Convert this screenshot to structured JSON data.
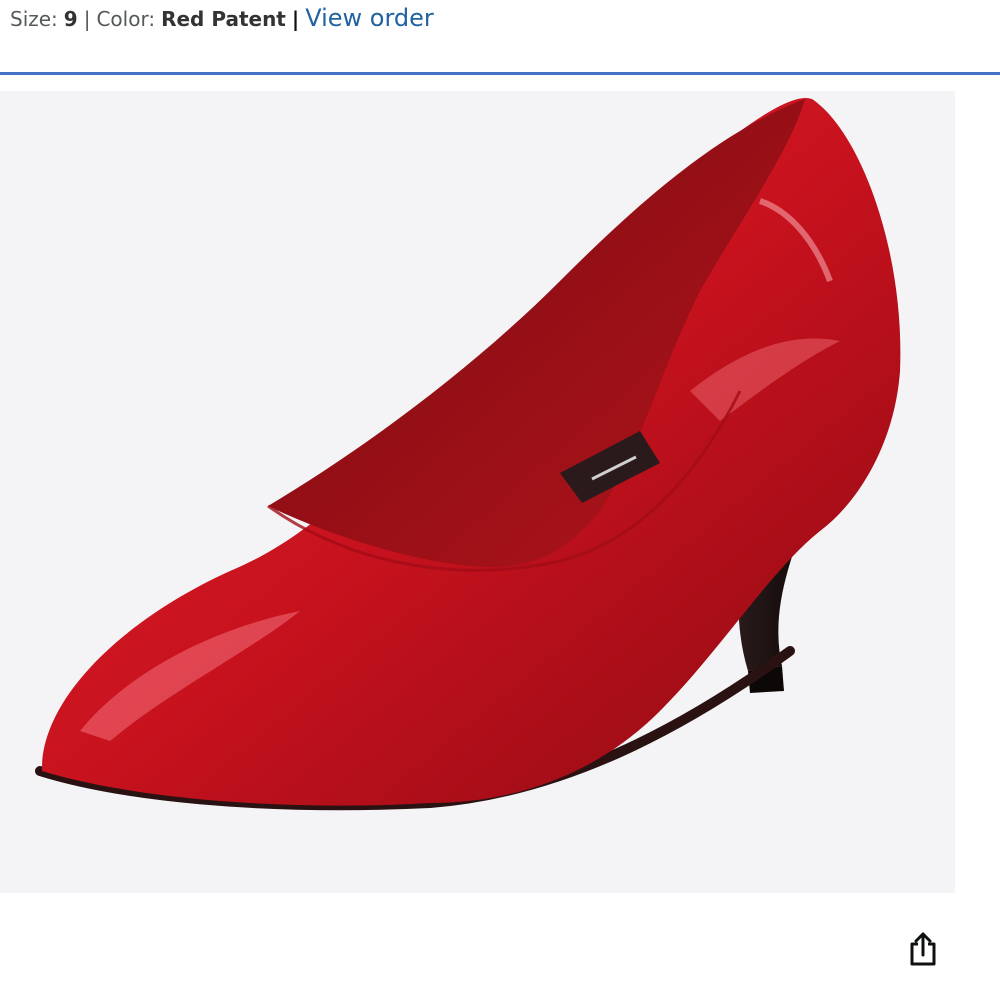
{
  "variant": {
    "size_label": "Size:",
    "size_value": "9",
    "separator_1": "|",
    "color_label": "Color:",
    "color_value": "Red Patent",
    "separator_2": "|",
    "view_order_link": "View order"
  },
  "product_image": {
    "alt": "Red patent pointed-toe pump with black heel"
  },
  "share_icon": "share-icon",
  "colors": {
    "accent_rule": "#4470c4",
    "link": "#2162a1",
    "image_background": "#f4f4f6",
    "shoe_red": "#c8121e",
    "heel_black": "#1a1212"
  }
}
